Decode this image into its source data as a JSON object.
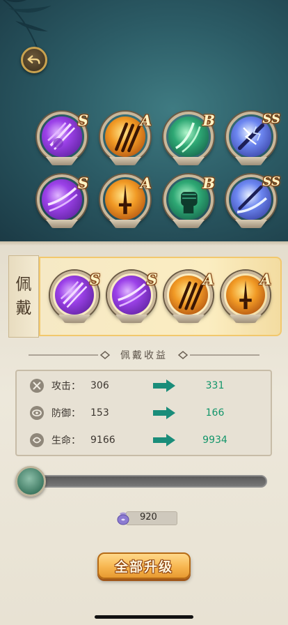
{
  "back_icon": "back-arrow-icon",
  "skill_grid": [
    {
      "grade": "S",
      "theme": "purple",
      "icon": "claw-strike-icon"
    },
    {
      "grade": "A",
      "theme": "orange",
      "icon": "triple-blade-icon"
    },
    {
      "grade": "B",
      "theme": "green",
      "icon": "wind-slash-icon"
    },
    {
      "grade": "SS",
      "theme": "blue",
      "icon": "lightning-sword-icon"
    },
    {
      "grade": "S",
      "theme": "purple",
      "icon": "purple-slash-icon"
    },
    {
      "grade": "A",
      "theme": "orange",
      "icon": "flame-sword-icon"
    },
    {
      "grade": "B",
      "theme": "green",
      "icon": "fist-icon"
    },
    {
      "grade": "SS",
      "theme": "blue",
      "icon": "storm-slash-icon"
    }
  ],
  "equipped": {
    "label": [
      "佩",
      "戴"
    ],
    "skills": [
      {
        "grade": "S",
        "theme": "purple",
        "icon": "claw-strike-icon"
      },
      {
        "grade": "S",
        "theme": "purple",
        "icon": "purple-slash-icon"
      },
      {
        "grade": "A",
        "theme": "orange",
        "icon": "triple-blade-icon"
      },
      {
        "grade": "A",
        "theme": "orange",
        "icon": "flame-sword-icon"
      }
    ]
  },
  "benefits": {
    "title": "佩戴收益",
    "stats": [
      {
        "label": "攻击：",
        "current": "306",
        "next": "331",
        "icon": "attack-icon"
      },
      {
        "label": "防御：",
        "current": "153",
        "next": "166",
        "icon": "defense-icon"
      },
      {
        "label": "生命：",
        "current": "9166",
        "next": "9934",
        "icon": "life-icon"
      }
    ]
  },
  "slider": {
    "level": 0
  },
  "cost": {
    "value": "920",
    "icon": "coin-pouch-icon"
  },
  "upgrade_button": {
    "label": "全部升级"
  },
  "colors": {
    "accent_green": "#12956a",
    "button_orange": "#f7b650"
  }
}
